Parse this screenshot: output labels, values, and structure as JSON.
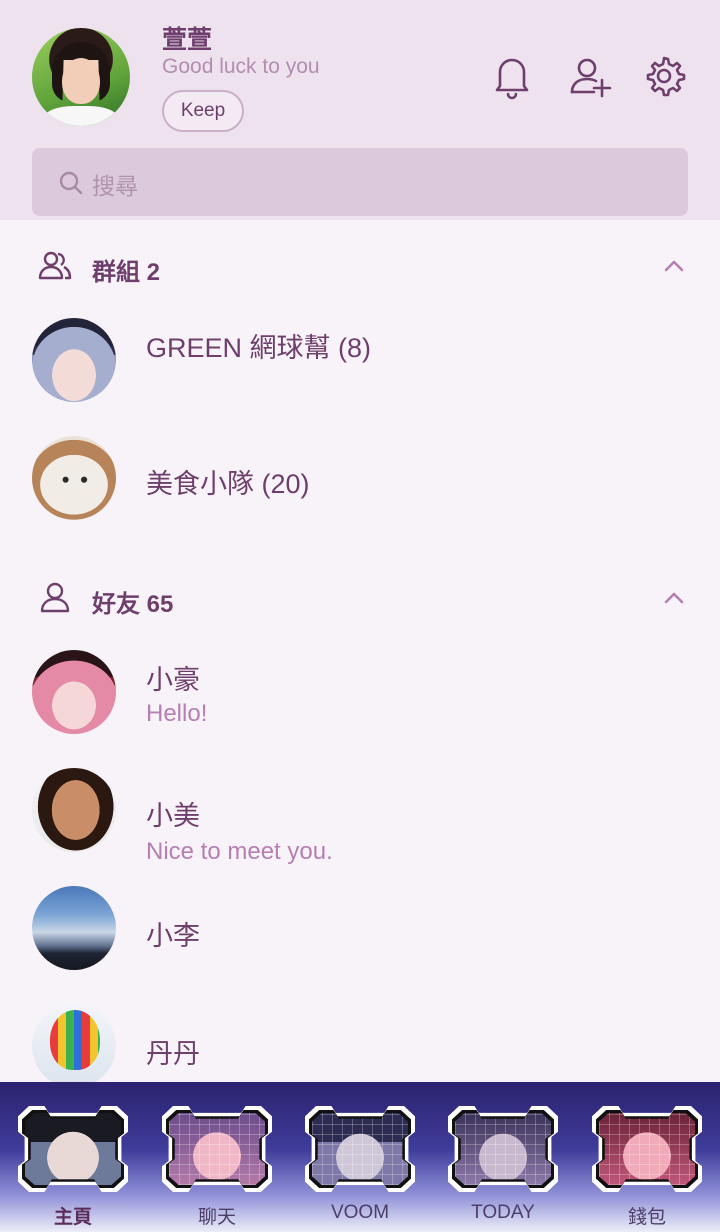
{
  "profile": {
    "name": "萱萱",
    "status": "Good luck to you",
    "keep_label": "Keep"
  },
  "header_icons": [
    "bell-icon",
    "add-friend-icon",
    "gear-icon"
  ],
  "search": {
    "placeholder": "搜尋"
  },
  "groups": {
    "title": "群組 2",
    "items": [
      {
        "name": "GREEN 網球幫 (8)"
      },
      {
        "name": "美食小隊 (20)"
      }
    ]
  },
  "friends": {
    "title": "好友 65",
    "items": [
      {
        "name": "小豪",
        "message": "Hello!"
      },
      {
        "name": "小美",
        "message": "Nice to meet you."
      },
      {
        "name": "小李",
        "message": ""
      },
      {
        "name": "丹丹",
        "message": ""
      }
    ]
  },
  "bottom_nav": {
    "tabs": [
      {
        "label": "主頁",
        "active": true
      },
      {
        "label": "聊天",
        "active": false
      },
      {
        "label": "VOOM",
        "active": false
      },
      {
        "label": "TODAY",
        "active": false
      },
      {
        "label": "錢包",
        "active": false
      }
    ]
  },
  "colors": {
    "accent": "#6e3f6c",
    "header_bg": "#efe2ef",
    "list_bg": "#f8f3f8",
    "message": "#b57fb3"
  }
}
